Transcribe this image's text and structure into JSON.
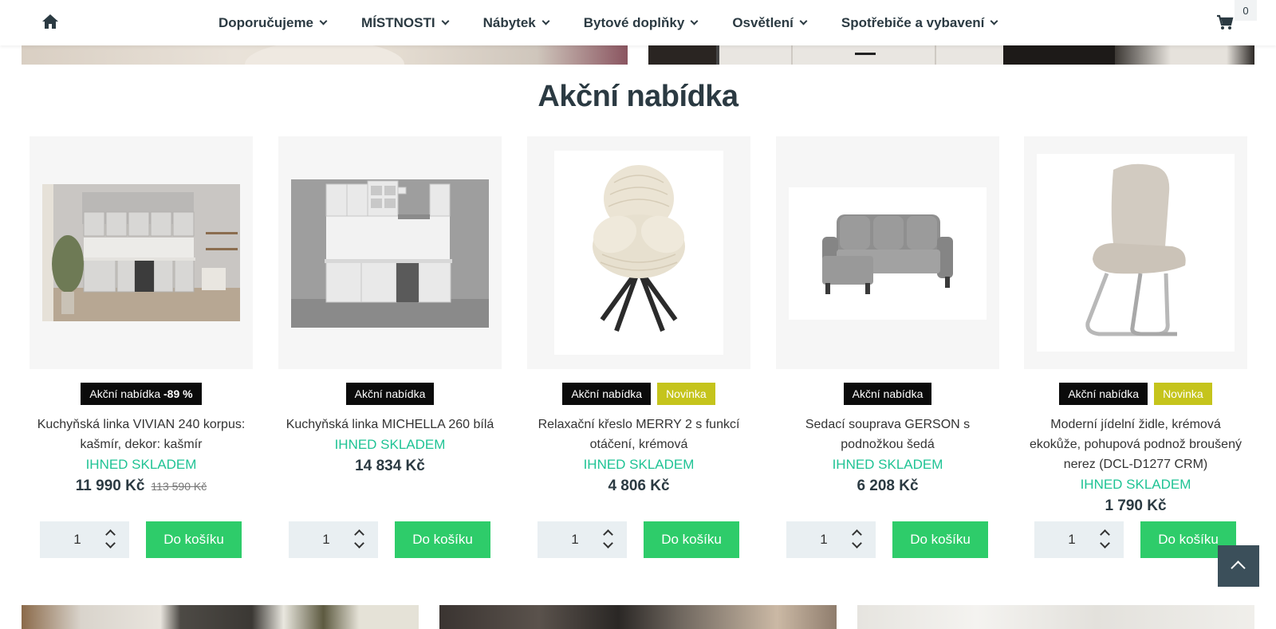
{
  "nav": {
    "items": [
      {
        "label": "Doporučujeme"
      },
      {
        "label": "MÍSTNOSTI"
      },
      {
        "label": "Nábytek"
      },
      {
        "label": "Bytové doplňky"
      },
      {
        "label": "Osvětlení"
      },
      {
        "label": "Spotřebiče a vybavení"
      }
    ],
    "cart_count": "0"
  },
  "section": {
    "title": "Akční nabídka"
  },
  "products": [
    {
      "badge_action": "Akční nabídka",
      "badge_discount": "-89 %",
      "badge_new": "",
      "name": "Kuchyňská linka VIVIAN 240 korpus: kašmír, dekor: kašmír",
      "stock": "IHNED SKLADEM",
      "price": "11 990 Kč",
      "old_price": "113 590 Kč",
      "qty": "1",
      "button": "Do košíku"
    },
    {
      "badge_action": "Akční nabídka",
      "badge_discount": "",
      "badge_new": "",
      "name": "Kuchyňská linka MICHELLA 260 bílá",
      "stock": "IHNED SKLADEM",
      "price": "14 834 Kč",
      "old_price": "",
      "qty": "1",
      "button": "Do košíku"
    },
    {
      "badge_action": "Akční nabídka",
      "badge_discount": "",
      "badge_new": "Novinka",
      "name": "Relaxační křeslo MERRY 2 s funkcí otáčení, krémová",
      "stock": "IHNED SKLADEM",
      "price": "4 806 Kč",
      "old_price": "",
      "qty": "1",
      "button": "Do košíku"
    },
    {
      "badge_action": "Akční nabídka",
      "badge_discount": "",
      "badge_new": "",
      "name": "Sedací souprava GERSON s podnožkou šedá",
      "stock": "IHNED SKLADEM",
      "price": "6 208 Kč",
      "old_price": "",
      "qty": "1",
      "button": "Do košíku"
    },
    {
      "badge_action": "Akční nabídka",
      "badge_discount": "",
      "badge_new": "Novinka",
      "name": "Moderní jídelní židle, krémová ekokůže, pohupová podnož broušený nerez (DCL-D1277 CRM)",
      "stock": "IHNED SKLADEM",
      "price": "1 790 Kč",
      "old_price": "",
      "qty": "1",
      "button": "Do košíku"
    }
  ],
  "colors": {
    "stock": "#1fc394",
    "button": "#2ecc6a",
    "new_badge": "#c5c41c",
    "text": "#2b3a42"
  }
}
